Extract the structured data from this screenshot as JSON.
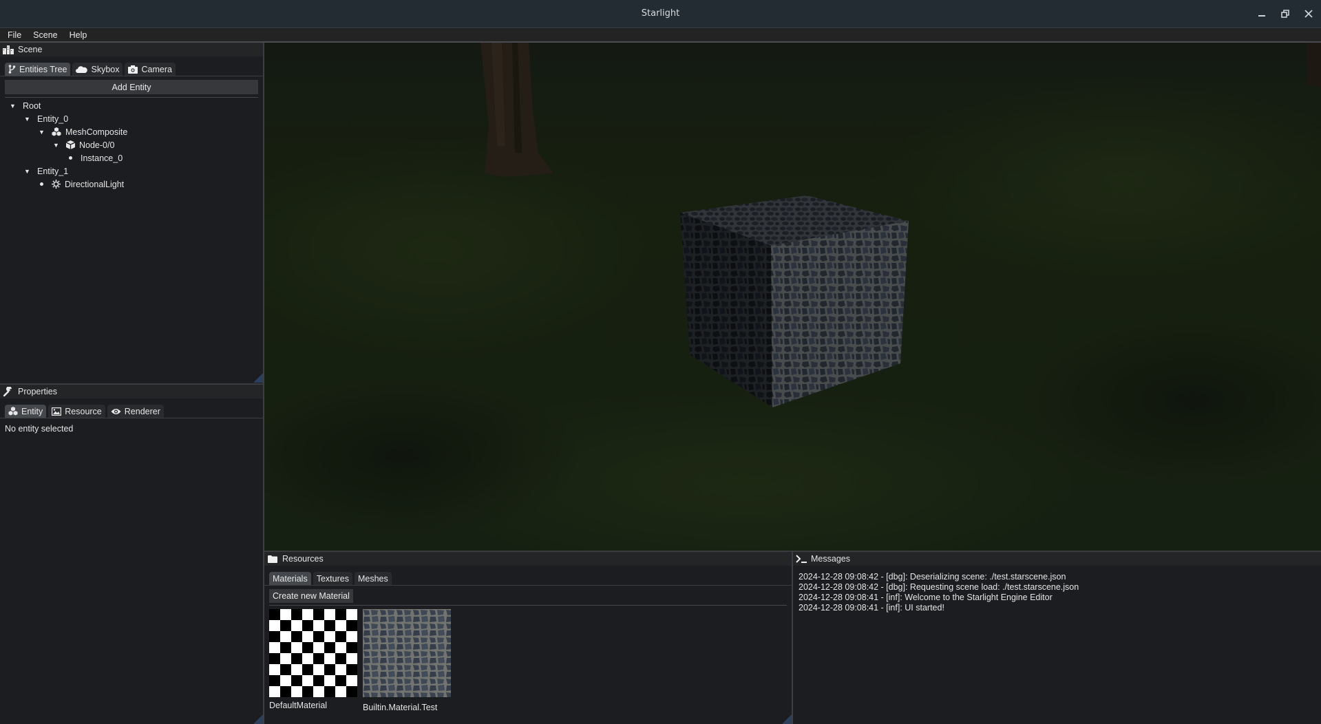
{
  "window": {
    "title": "Starlight",
    "controls": {
      "minimize": "minimize-icon",
      "maximize": "restore-icon",
      "close": "close-icon"
    }
  },
  "menu": [
    "File",
    "Scene",
    "Help"
  ],
  "scene_panel": {
    "title": "Scene",
    "icon": "city-icon",
    "tabs": [
      {
        "label": "Entities Tree",
        "icon": "branch-icon",
        "active": true
      },
      {
        "label": "Skybox",
        "icon": "cloud-icon",
        "active": false
      },
      {
        "label": "Camera",
        "icon": "camera-icon",
        "active": false
      }
    ],
    "add_entity_label": "Add Entity",
    "tree": [
      {
        "label": "Root",
        "depth": 0,
        "expanded": true,
        "leaf": false,
        "icon": null
      },
      {
        "label": "Entity_0",
        "depth": 1,
        "expanded": true,
        "leaf": false,
        "icon": null
      },
      {
        "label": "MeshComposite",
        "depth": 2,
        "expanded": true,
        "leaf": false,
        "icon": "cubes-icon"
      },
      {
        "label": "Node-0/0",
        "depth": 3,
        "expanded": true,
        "leaf": false,
        "icon": "cube-icon"
      },
      {
        "label": "Instance_0",
        "depth": 4,
        "expanded": false,
        "leaf": true,
        "icon": null
      },
      {
        "label": "Entity_1",
        "depth": 1,
        "expanded": true,
        "leaf": false,
        "icon": null
      },
      {
        "label": "DirectionalLight",
        "depth": 2,
        "expanded": false,
        "leaf": true,
        "icon": "sun-icon"
      }
    ]
  },
  "properties_panel": {
    "title": "Properties",
    "icon": "wrench-icon",
    "tabs": [
      {
        "label": "Entity",
        "icon": "cubes-icon",
        "active": true
      },
      {
        "label": "Resource",
        "icon": "image-icon",
        "active": false
      },
      {
        "label": "Renderer",
        "icon": "eye-icon",
        "active": false
      }
    ],
    "empty_text": "No entity selected"
  },
  "viewport": {
    "scene": "cube-on-grass",
    "cube_material": "Builtin.Material.Test"
  },
  "resources_panel": {
    "title": "Resources",
    "icon": "folder-icon",
    "tabs": [
      {
        "label": "Materials",
        "active": true
      },
      {
        "label": "Textures",
        "active": false
      },
      {
        "label": "Meshes",
        "active": false
      }
    ],
    "create_label": "Create new Material",
    "materials": [
      {
        "name": "DefaultMaterial",
        "preview": "checkerboard"
      },
      {
        "name": "Builtin.Material.Test",
        "preview": "cobblestone"
      }
    ]
  },
  "messages_panel": {
    "title": "Messages",
    "icon": "terminal-icon",
    "lines": [
      "2024-12-28 09:08:42 - [dbg]: Deserializing scene: ./test.starscene.json",
      "2024-12-28 09:08:42 - [dbg]: Requesting scene load: ./test.starscene.json",
      "2024-12-28 09:08:41 - [inf]: Welcome to the Starlight Engine Editor",
      "2024-12-28 09:08:41 - [inf]: UI started!"
    ]
  },
  "colors": {
    "titlebar": "#232c33",
    "panel_bg": "#1c1d20",
    "header_bg": "#242527",
    "tab_active": "#44474b",
    "tab_inactive": "#2a2b2e",
    "button_bg": "#36383b",
    "grip": "#2b3e5c"
  }
}
